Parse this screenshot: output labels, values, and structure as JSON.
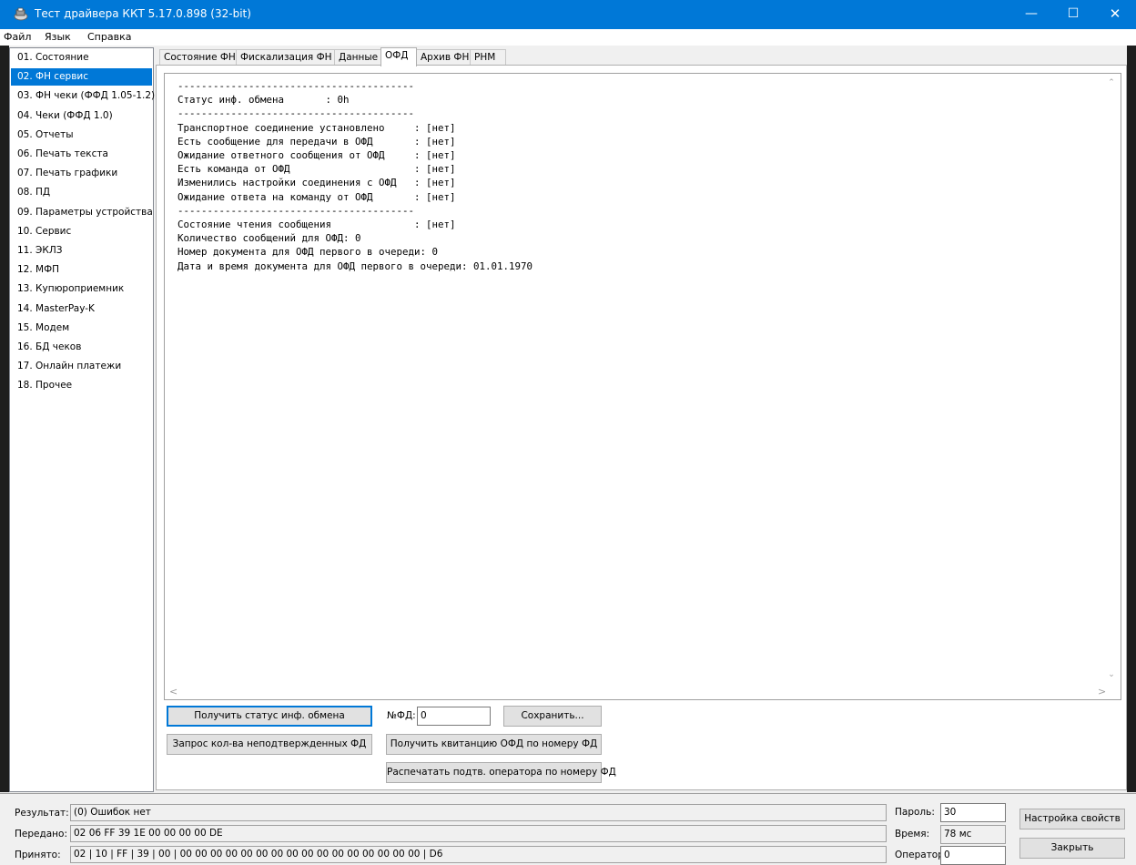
{
  "window": {
    "title": "Тест драйвера ККТ 5.17.0.898 (32-bit)",
    "minimize": "—",
    "maximize": "☐",
    "close": "✕"
  },
  "menu": [
    "Файл",
    "Язык",
    "Справка"
  ],
  "sidebar": {
    "selected_index": 1,
    "items": [
      "01. Состояние",
      "02. ФН сервис",
      "03. ФН чеки (ФФД 1.05-1.2)",
      "04. Чеки (ФФД 1.0)",
      "05. Отчеты",
      "06. Печать текста",
      "07. Печать графики",
      "08. ПД",
      "09. Параметры устройства",
      "10. Сервис",
      "11. ЭКЛЗ",
      "12. МФП",
      "13. Купюроприемник",
      "14. MasterPay-K",
      "15. Модем",
      "16. БД чеков",
      "17. Онлайн платежи",
      "18. Прочее"
    ]
  },
  "tabs": {
    "active_index": 3,
    "items": [
      "Состояние ФН",
      "Фискализация ФН",
      "Данные",
      "ОФД",
      "Архив ФН",
      "РНМ"
    ]
  },
  "output": {
    "text": "----------------------------------------\nСтатус инф. обмена       : 0h\n----------------------------------------\nТранспортное соединение установлено     : [нет]\nЕсть сообщение для передачи в ОФД       : [нет]\nОжидание ответного сообщения от ОФД     : [нет]\nЕсть команда от ОФД                     : [нет]\nИзменились настройки соединения с ОФД   : [нет]\nОжидание ответа на команду от ОФД       : [нет]\n----------------------------------------\nСостояние чтения сообщения              : [нет]\nКоличество сообщений для ОФД: 0\nНомер документа для ОФД первого в очереди: 0\nДата и время документа для ОФД первого в очереди: 01.01.1970"
  },
  "controls": {
    "get_status_button": "Получить статус инф. обмена",
    "fd_number_label": "№ФД:",
    "fd_number_value": "0",
    "save_button": "Сохранить...",
    "request_unconfirmed_button": "Запрос кол-ва неподтвержденных ФД",
    "get_receipt_button": "Получить квитанцию ОФД по номеру ФД",
    "print_confirmation_button": "Распечатать подтв. оператора по номеру ФД"
  },
  "status": {
    "result_label": "Результат:",
    "result_value": "(0) Ошибок нет",
    "sent_label": "Передано:",
    "sent_value": "02 06 FF 39 1E 00 00 00 00 DE",
    "received_label": "Принято:",
    "received_value": "02 | 10 | FF | 39 | 00 | 00 00 00 00 00 00 00 00 00 00 00 00 00 00 00 00 | D6",
    "password_label": "Пароль:",
    "password_value": "30",
    "time_label": "Время:",
    "time_value": "78 мс",
    "operator_label": "Оператор:",
    "operator_value": "0",
    "settings_button": "Настройка свойств",
    "close_button": "Закрыть"
  },
  "colors": {
    "titlebar": "#0078d7",
    "selection": "#0078d7"
  }
}
